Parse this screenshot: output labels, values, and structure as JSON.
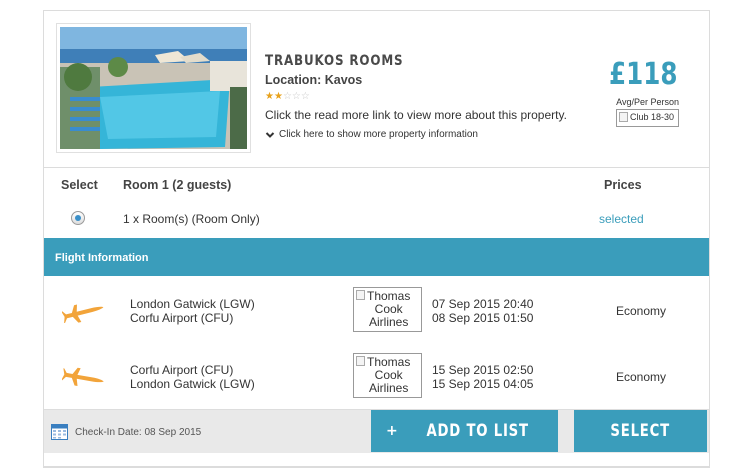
{
  "hotel": {
    "name": "Trabukos Rooms",
    "location_label": "Location:",
    "location_value": "Kavos",
    "rating": 2,
    "rating_max": 5,
    "description": "Click the read more link to view more about this property.",
    "more_info_link": "Click here to show more property information",
    "price": "£118",
    "price_sub": "Avg/Per Person",
    "club_badge_alt": "Club 18-30"
  },
  "room_table": {
    "col_select": "Select",
    "col_room": "Room 1 (2 guests)",
    "col_prices": "Prices",
    "row_desc": "1 x Room(s) (Room Only)",
    "row_price_status": "selected"
  },
  "flights": {
    "section_title": "Flight Information",
    "rows": [
      {
        "from": "London Gatwick (LGW)",
        "to": "Corfu Airport (CFU)",
        "airline_alt_1": "Thomas",
        "airline_alt_2": "Cook",
        "airline_alt_3": "Airlines",
        "depart": "07 Sep 2015 20:40",
        "arrive": "08 Sep 2015 01:50",
        "cabin": "Economy",
        "direction": "outbound"
      },
      {
        "from": "Corfu Airport (CFU)",
        "to": "London Gatwick (LGW)",
        "airline_alt_1": "Thomas",
        "airline_alt_2": "Cook",
        "airline_alt_3": "Airlines",
        "depart": "15 Sep 2015 02:50",
        "arrive": "15 Sep 2015 04:05",
        "cabin": "Economy",
        "direction": "return"
      }
    ]
  },
  "footer": {
    "checkin": "Check-In Date: 08 Sep 2015",
    "add_to_list_label": "Add to list",
    "add_icon": "+",
    "select_label": "Select"
  },
  "colors": {
    "accent": "#3a9dbb",
    "plane": "#f2a43a",
    "star_on": "#e8a21c",
    "footer_bg": "#e9e9e9"
  }
}
